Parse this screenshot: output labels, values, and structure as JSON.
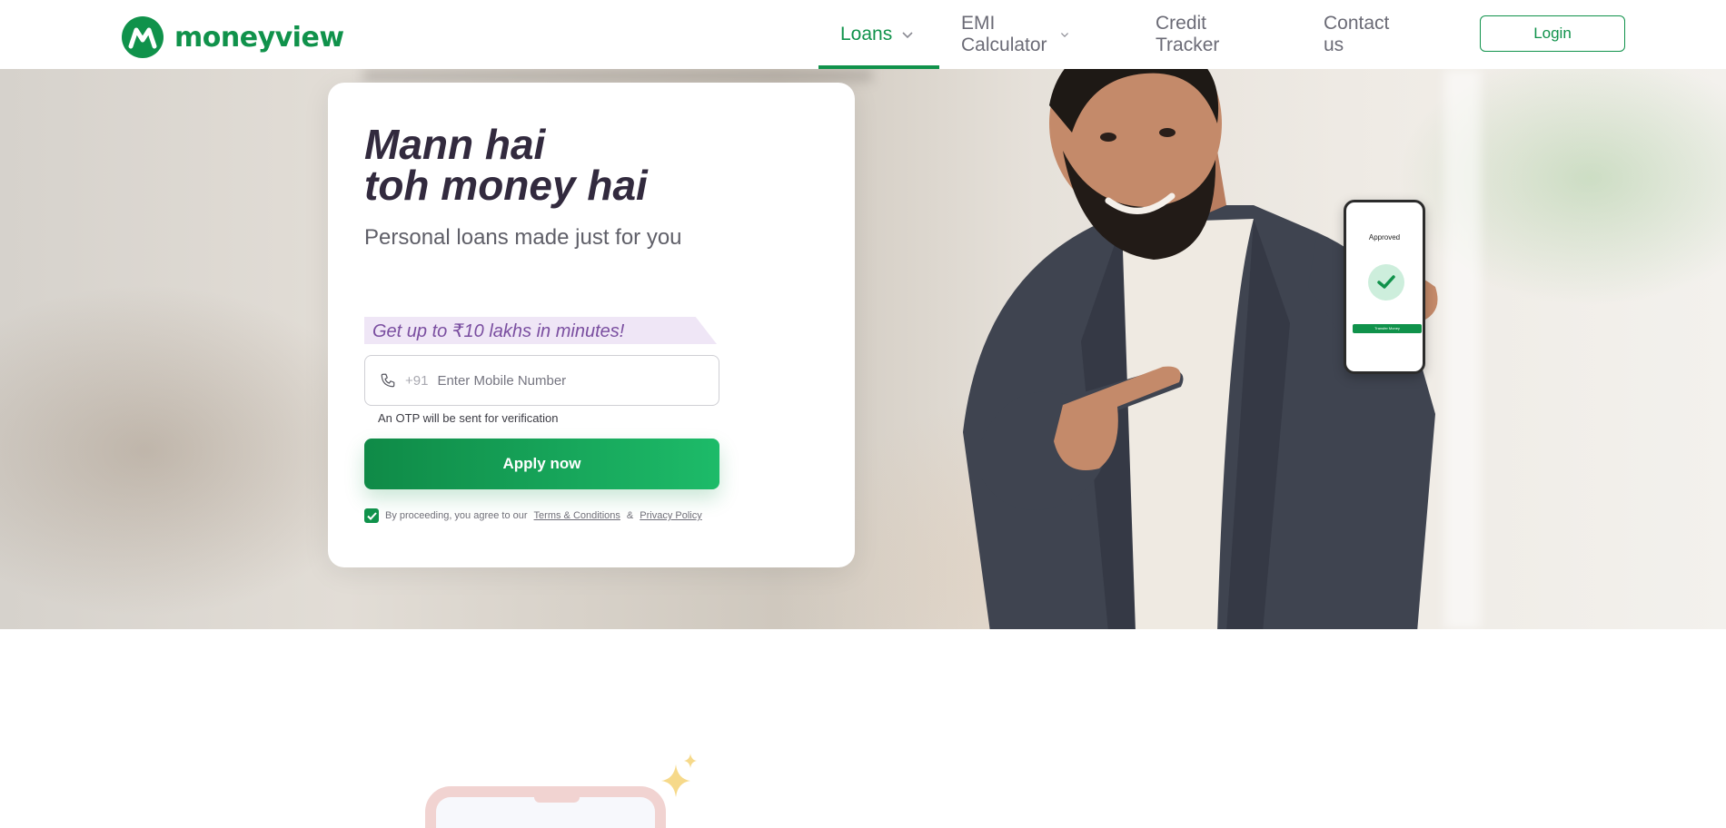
{
  "brand": {
    "name": "moneyview",
    "color": "#10924b"
  },
  "nav": {
    "items": [
      {
        "label": "Loans",
        "active": true,
        "dropdown": true
      },
      {
        "label": "EMI Calculator",
        "active": false,
        "dropdown": true
      },
      {
        "label": "Credit Tracker",
        "active": false,
        "dropdown": false
      },
      {
        "label": "Contact us",
        "active": false,
        "dropdown": false
      }
    ],
    "login_label": "Login"
  },
  "hero": {
    "headline_line1": "Mann hai",
    "headline_line2": "toh money hai",
    "subheading": "Personal loans made just for you",
    "promo": "Get up to ₹10 lakhs in minutes!",
    "phone_prefix": "+91",
    "phone_placeholder": "Enter Mobile Number",
    "otp_note": "An OTP will be sent for verification",
    "apply_label": "Apply now",
    "consent_text": "By proceeding, you agree to our",
    "terms_label": "Terms & Conditions",
    "and_sep": "&",
    "privacy_label": "Privacy Policy",
    "consent_checked": true
  },
  "phone_screen": {
    "title": "Approved",
    "button_label": "Transfer Money"
  },
  "icons": [
    "moneyview-logo-icon",
    "chevron-down-icon",
    "phone-icon",
    "checkmark-icon",
    "sparkle-icon"
  ]
}
